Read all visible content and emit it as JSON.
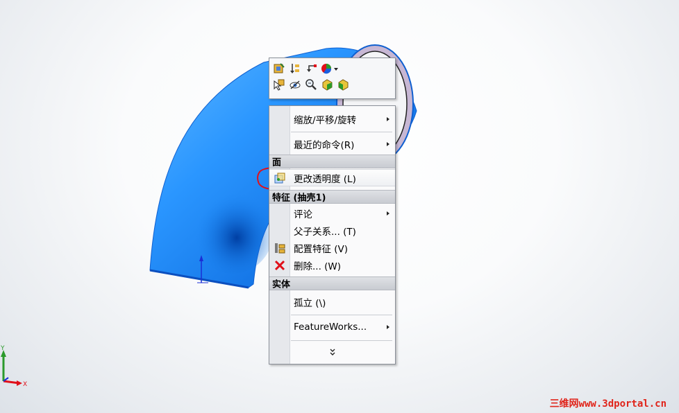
{
  "context_menu": {
    "items_top": [
      {
        "label": "缩放/平移/旋转",
        "has_submenu": true
      },
      {
        "label": "最近的命令(R)",
        "has_submenu": true
      }
    ],
    "section_face": {
      "header": "面",
      "items": [
        {
          "label": "更改透明度 (L)",
          "icon": "transparency-icon",
          "highlighted": true
        }
      ]
    },
    "section_feature": {
      "header": "特征 (抽壳1)",
      "items": [
        {
          "label": "评论",
          "has_submenu": true
        },
        {
          "label": "父子关系... (T)"
        },
        {
          "label": "配置特征 (V)",
          "icon": "configure-feature-icon"
        },
        {
          "label": "删除... (W)",
          "icon": "delete-x-icon"
        }
      ]
    },
    "section_body": {
      "header": "实体",
      "items": [
        {
          "label": "孤立 (\\)"
        },
        {
          "label": "FeatureWorks...",
          "has_submenu": true
        }
      ]
    },
    "more_chevron": "»"
  },
  "toolbar_icons": [
    "edit-feature-icon",
    "rollback-icon",
    "parent-child-icon",
    "appearance-icon",
    "select-other-icon",
    "hide-icon",
    "zoom-to-selection-icon",
    "normal-to-icon",
    "view-orientation-icon"
  ],
  "triad": {
    "x_label": "X",
    "y_label": "Y"
  },
  "watermark": "三维网www.3dportal.cn",
  "colors": {
    "model_blue": "#1e8fff",
    "annotation_red": "#e0101a",
    "watermark_red": "#e0241a"
  }
}
